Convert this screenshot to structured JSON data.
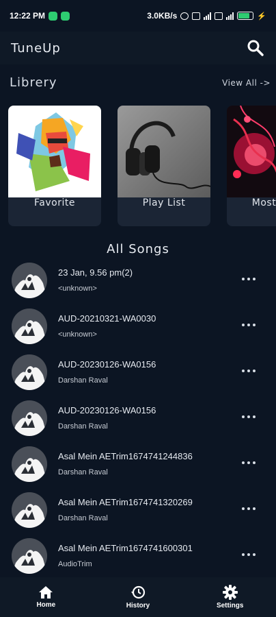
{
  "status": {
    "time": "12:22 PM",
    "network_speed": "3.0KB/s",
    "battery_level": 0.7
  },
  "header": {
    "title": "TuneUp",
    "search_icon": "search-icon"
  },
  "library": {
    "title": "Librery",
    "view_all": "View All ->",
    "cards": [
      {
        "label": "Favorite",
        "art": "pop-art-singer"
      },
      {
        "label": "Play List",
        "art": "headphones"
      },
      {
        "label": "Mostly P",
        "art": "abstract-red-music"
      }
    ]
  },
  "all_songs": {
    "title": "All Songs",
    "items": [
      {
        "title": "23 Jan, 9.56 pm(2)",
        "artist": "<unknown>"
      },
      {
        "title": "AUD-20210321-WA0030",
        "artist": "<unknown>"
      },
      {
        "title": "AUD-20230126-WA0156",
        "artist": "Darshan Raval"
      },
      {
        "title": "AUD-20230126-WA0156",
        "artist": "Darshan Raval"
      },
      {
        "title": "Asal Mein AETrim1674741244836",
        "artist": "Darshan Raval"
      },
      {
        "title": "Asal Mein AETrim1674741320269",
        "artist": "Darshan Raval"
      },
      {
        "title": "Asal Mein AETrim1674741600301",
        "artist": "AudioTrim"
      }
    ]
  },
  "nav": {
    "items": [
      {
        "label": "Home",
        "icon": "home-icon",
        "active": true
      },
      {
        "label": "History",
        "icon": "history-icon",
        "active": false
      },
      {
        "label": "Settings",
        "icon": "gear-icon",
        "active": false
      }
    ]
  },
  "colors": {
    "background": "#0c1523",
    "bar": "#0f1926",
    "card": "#1b2535"
  }
}
